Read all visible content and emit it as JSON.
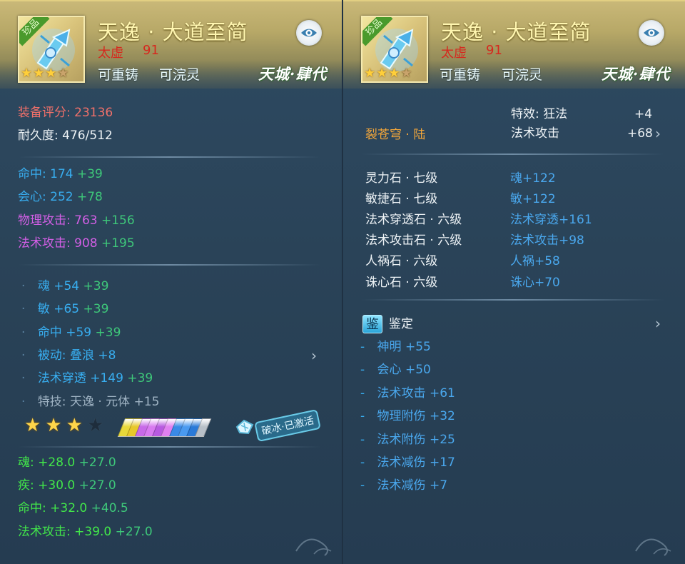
{
  "item": {
    "rarity_tag": "珍品",
    "name": "天逸 · 大道至简",
    "school": "太虚",
    "level": "91",
    "flag_recast": "可重铸",
    "flag_wash": "可浣灵",
    "series_logo": "天城·肆代",
    "stars_filled": 3,
    "stars_total": 4
  },
  "left": {
    "score_label": "装备评分:",
    "score_value": "23136",
    "durability_label": "耐久度:",
    "durability_value": "476/512",
    "base_stats": [
      {
        "label": "命中:",
        "value": "174",
        "bonus": "+39",
        "color": "#38aef0"
      },
      {
        "label": "会心:",
        "value": "252",
        "bonus": "+78",
        "color": "#38aef0"
      },
      {
        "label": "物理攻击:",
        "value": "763",
        "bonus": "+156",
        "color": "#d35fe6"
      },
      {
        "label": "法术攻击:",
        "value": "908",
        "bonus": "+195",
        "color": "#d35fe6"
      }
    ],
    "bullet_stats": [
      {
        "label": "魂",
        "value": "+54",
        "bonus": "+39"
      },
      {
        "label": "敏",
        "value": "+65",
        "bonus": "+39"
      },
      {
        "label": "命中",
        "value": "+59",
        "bonus": "+39"
      },
      {
        "label": "被动: 叠浪",
        "value": "+8",
        "bonus": ""
      },
      {
        "label": "法术穿透",
        "value": "+149",
        "bonus": "+39"
      },
      {
        "label": "特技: 天逸 · 元体",
        "value": "+15",
        "bonus": ""
      }
    ],
    "bullet_char": "·",
    "refine_stars_filled": 3,
    "refine_stars_total": 4,
    "gem_colors": [
      "#e8d83a",
      "#e8c82a",
      "#c86ae8",
      "#d87af0",
      "#b85ae0",
      "#e080f0",
      "#3a8ae8",
      "#4a9af0",
      "#2a7ad8",
      "#b8c0c8"
    ],
    "ice_badge": "破冰·已激活",
    "extra_stats": [
      {
        "label": "魂:",
        "value": "+28.0",
        "bonus": "+27.0"
      },
      {
        "label": "疾:",
        "value": "+30.0",
        "bonus": "+27.0"
      },
      {
        "label": "命中:",
        "value": "+32.0",
        "bonus": "+40.5"
      },
      {
        "label": "法术攻击:",
        "value": "+39.0",
        "bonus": "+27.0"
      }
    ]
  },
  "right": {
    "special_label": "特效: 狂法",
    "special_value": "+4",
    "magic_attack_label": "法术攻击",
    "magic_attack_value": "+68",
    "set_name": "裂苍穹 · 陆",
    "gems": [
      {
        "name": "灵力石 · 七级",
        "effect": "魂+122"
      },
      {
        "name": "敏捷石 · 七级",
        "effect": "敏+122"
      },
      {
        "name": "法术穿透石 · 六级",
        "effect": "法术穿透+161"
      },
      {
        "name": "法术攻击石 · 六级",
        "effect": "法术攻击+98"
      },
      {
        "name": "人祸石 · 六级",
        "effect": "人祸+58"
      },
      {
        "name": "诛心石 · 六级",
        "effect": "诛心+70"
      }
    ],
    "appraisal_icon": "鉴",
    "appraisal_label": "鉴定",
    "appraisal_stats": [
      {
        "label": "神明",
        "value": "+55"
      },
      {
        "label": "会心",
        "value": "+50"
      },
      {
        "label": "法术攻击",
        "value": "+61"
      },
      {
        "label": "物理附伤",
        "value": "+32"
      },
      {
        "label": "法术附伤",
        "value": "+25"
      },
      {
        "label": "法术减伤",
        "value": "+17"
      },
      {
        "label": "法术减伤",
        "value": "+7"
      }
    ],
    "dash_char": "-"
  },
  "icons": {
    "eye": "eye-icon",
    "chevron": "chevron-right-icon",
    "star": "star-icon"
  }
}
